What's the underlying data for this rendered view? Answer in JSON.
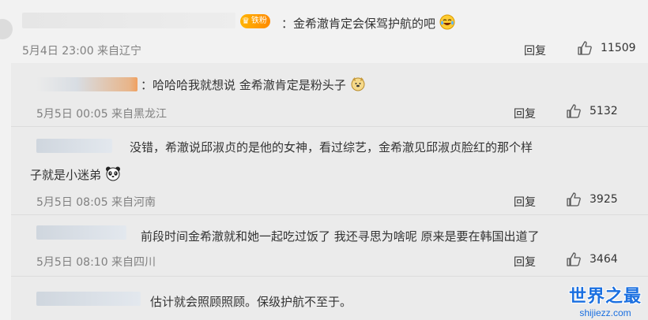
{
  "top_comment": {
    "badge": "铁粉",
    "text": "：金希澈肯定会保驾护航的吧",
    "meta": "5月4日 23:00 来自辽宁",
    "reply_label": "回复",
    "likes": "11509"
  },
  "replies": [
    {
      "text": "：哈哈哈我就想说 金希澈肯定是粉头子",
      "meta": "5月5日 00:05 来自黑龙江",
      "reply_label": "回复",
      "likes": "5132"
    },
    {
      "text_line1": "没错，希澈说邱淑贞的是他的女神，看过综艺，金希澈见邱淑贞脸红的那个样",
      "text_line2": "子就是小迷弟",
      "meta": "5月5日 08:05 来自河南",
      "reply_label": "回复",
      "likes": "3925"
    },
    {
      "text": "前段时间金希澈就和她一起吃过饭了 我还寻思为啥呢 原来是要在韩国出道了",
      "meta": "5月5日 08:10 来自四川",
      "reply_label": "回复",
      "likes": "3464"
    },
    {
      "text": "估计就会照顾照顾。保级护航不至于。"
    }
  ],
  "watermark": {
    "title": "世界之最",
    "url": "shijiezz.com"
  }
}
